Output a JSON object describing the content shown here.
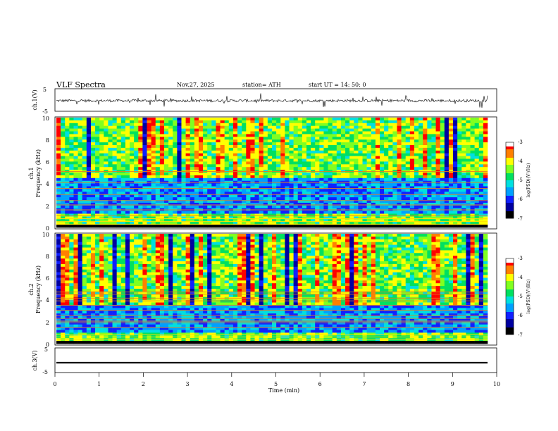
{
  "header": {
    "title": "VLF  Spectra",
    "date": "Nov.27, 2025",
    "station": "station= ATH",
    "start": "start  UT  =    14: 50: 0"
  },
  "chart_data": [
    {
      "type": "line",
      "ylabel": "ch.1(V)",
      "ylim": [
        -5,
        5
      ],
      "yticks": [
        "5",
        "-5"
      ],
      "xlim": [
        0,
        10
      ],
      "note": "broadband waveform, fluctuating around -0.3 V with spikes"
    },
    {
      "type": "heatmap",
      "ylabel": [
        "ch.1",
        "Frequency  (kHz)"
      ],
      "ylim": [
        0,
        10
      ],
      "yticks": [
        "0",
        "2",
        "4",
        "6",
        "8",
        "10"
      ],
      "xlim": [
        0,
        10
      ],
      "colorbar": {
        "label": "log(PSD)(V²/Hz)",
        "range": [
          -7,
          -3
        ],
        "ticks": [
          "-3",
          "-4",
          "-5",
          "-6",
          "-7"
        ]
      },
      "features": {
        "narrowband_lines_khz": [
          0.3,
          0.55,
          0.8,
          1.1,
          1.6,
          2.05,
          2.45,
          3.0,
          3.55,
          4.1,
          5.1
        ],
        "quiet_band_khz": [
          1.2,
          4.5
        ]
      }
    },
    {
      "type": "heatmap",
      "ylabel": [
        "ch.2",
        "Frequency  (kHz)"
      ],
      "ylim": [
        0,
        10
      ],
      "yticks": [
        "0",
        "2",
        "4",
        "6",
        "8",
        "10"
      ],
      "xlim": [
        0,
        10
      ],
      "colorbar": {
        "label": "log(PSD)(V²/Hz)",
        "range": [
          -7,
          -3
        ],
        "ticks": [
          "-3",
          "-4",
          "-5",
          "-6",
          "-7"
        ]
      },
      "features": {
        "narrowband_lines_khz": [
          0.4,
          0.6,
          0.85,
          1.45,
          1.9,
          2.05,
          2.3,
          2.6,
          3.05,
          3.5,
          3.9,
          4.15,
          4.5,
          4.7
        ],
        "quiet_band_khz": [
          1.0,
          3.6
        ]
      }
    },
    {
      "type": "line",
      "ylabel": "ch.3(V)",
      "ylim": [
        -5,
        5
      ],
      "yticks": [
        "5",
        "-5"
      ],
      "xlim": [
        0,
        10
      ],
      "values_constant": -1.0,
      "xlabel": "Time  (min)",
      "xticks": [
        "0",
        "1",
        "2",
        "3",
        "4",
        "5",
        "6",
        "7",
        "8",
        "9",
        "10"
      ]
    }
  ],
  "colors": {
    "colormap": [
      "#000000",
      "#0000a0",
      "#1020ff",
      "#00a0ff",
      "#00e0e0",
      "#00e060",
      "#80ff20",
      "#ffff00",
      "#ff8000",
      "#ff0000",
      "#ffffff"
    ]
  }
}
